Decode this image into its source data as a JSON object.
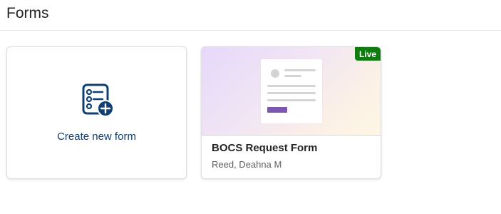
{
  "header": {
    "title": "Forms"
  },
  "create_card": {
    "label": "Create new form",
    "icon": "form-add-icon"
  },
  "form_cards": [
    {
      "name": "BOCS Request Form",
      "owner": "Reed, Deahna M",
      "status": "Live"
    }
  ],
  "colors": {
    "accent": "#0f3f73",
    "live_badge": "#107c10",
    "thumb_button": "#7b57b0"
  }
}
